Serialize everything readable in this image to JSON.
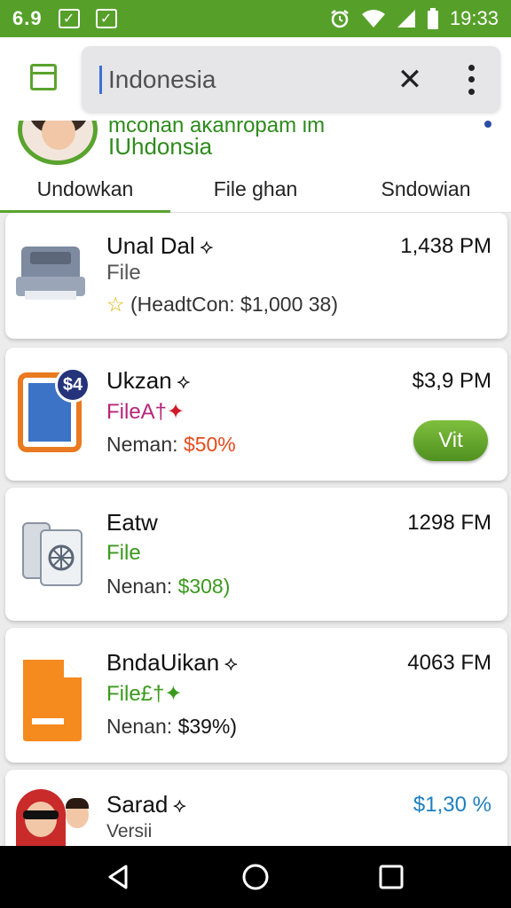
{
  "status_bar": {
    "time_left": "6.9",
    "clock": "19:33"
  },
  "search": {
    "query": "Indonesia"
  },
  "profile": {
    "line1": "mconan akanropam im",
    "line2": "IUhdonsia"
  },
  "tabs": [
    {
      "label": "Undowkan"
    },
    {
      "label": "File ghan"
    },
    {
      "label": "Sndowian"
    }
  ],
  "items": [
    {
      "title": "Unal Dal",
      "sub": "File",
      "detail_prefix": "☆",
      "detail": "(HeadtCon: $1,000 38)",
      "meta": "1,438 PM"
    },
    {
      "title": "Ukzan",
      "sub": "FileA†",
      "detail_label": "Neman: ",
      "detail_value": "$50%",
      "meta": "$3,9 PM",
      "badge": "$4",
      "button": "Vit"
    },
    {
      "title": "Eatw",
      "sub": "File",
      "detail_label": "Nenan: ",
      "detail_value": "$308)",
      "meta": "1298 FM"
    },
    {
      "title": "BndaUikan",
      "sub": "File£†",
      "detail_label": "Nenan: ",
      "detail_value": "$39%)",
      "meta": "4063 FM"
    },
    {
      "title": "Sarad",
      "sub": "Versii",
      "meta": "$1,30 %"
    }
  ],
  "colors": {
    "accent": "#56a02a",
    "magenta": "#b8257a",
    "orange": "#e34b1c",
    "green_text": "#3a9a1c",
    "blue_meta": "#1e7fc0"
  }
}
